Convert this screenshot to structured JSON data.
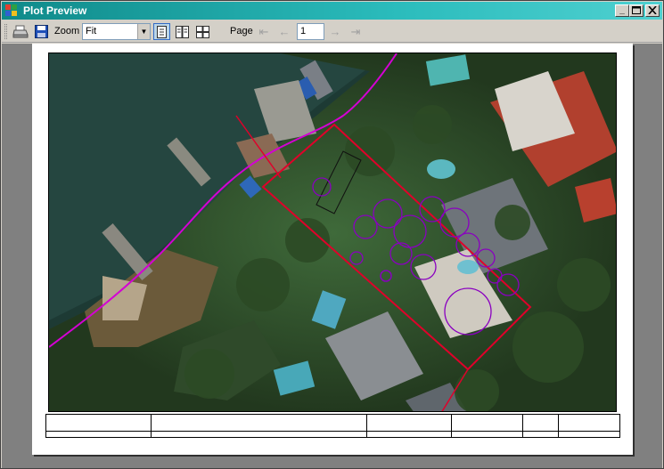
{
  "window": {
    "title": "Plot Preview",
    "title_color": "#ffffff",
    "titlebar_color": "#1fa7a7"
  },
  "toolbar": {
    "zoom_label": "Zoom",
    "zoom_value": "Fit",
    "page_label": "Page",
    "page_value": "1"
  },
  "icons": {
    "print": "printer-icon",
    "save": "floppy-disk-icon",
    "single_page": "single-page-icon",
    "two_pages": "two-pages-icon",
    "four_pages": "four-pages-icon",
    "first": "first-page-icon",
    "prev": "previous-page-icon",
    "next": "next-page-icon",
    "last": "last-page-icon"
  },
  "colors": {
    "boundary_red": "#e0002a",
    "contour_magenta": "#d400d4",
    "tree_purple": "#8a00c0"
  }
}
